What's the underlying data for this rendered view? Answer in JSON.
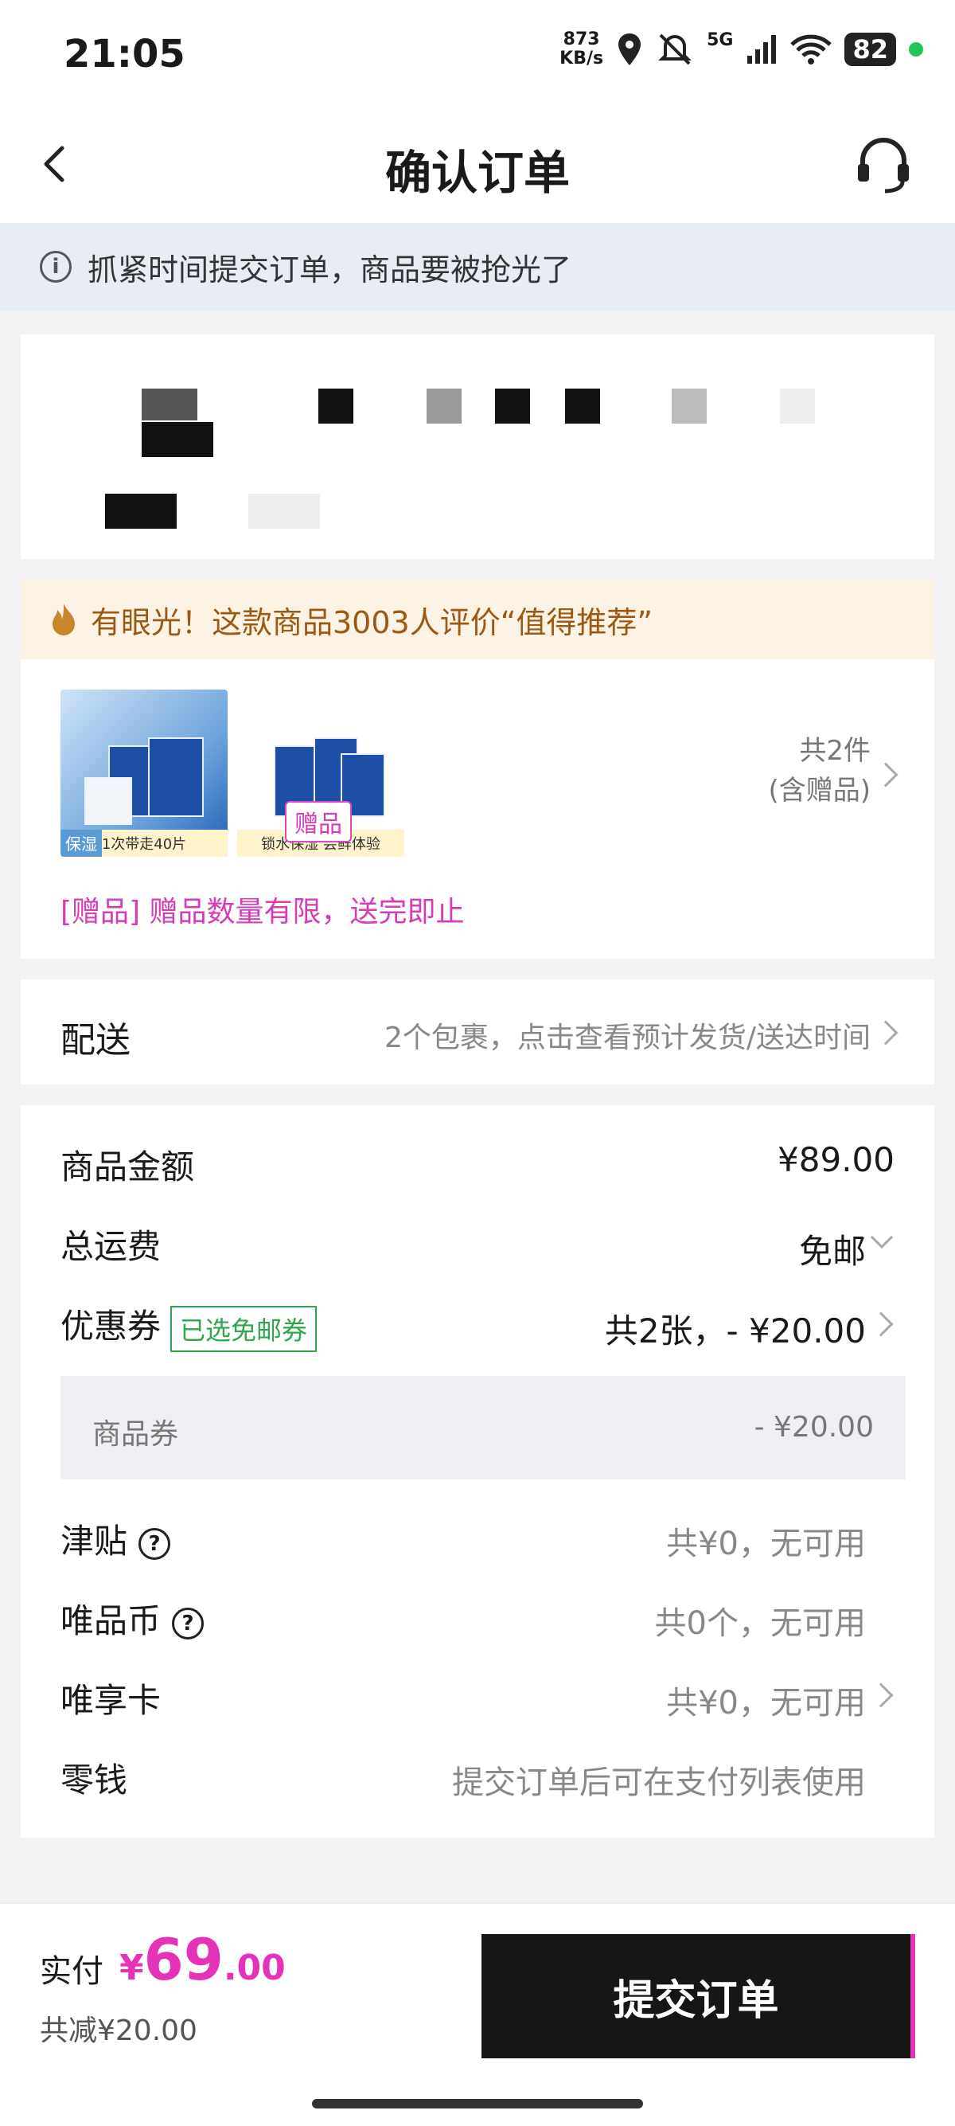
{
  "status_bar": {
    "time": "21:05",
    "net_speed_value": "873",
    "net_speed_unit": "KB/s",
    "signal": "5G",
    "battery": "82"
  },
  "nav": {
    "title": "确认订单"
  },
  "notice": {
    "text": "抓紧时间提交订单，商品要被抢光了"
  },
  "recommend": {
    "text": "有眼光！这款商品3003人评价“值得推荐”"
  },
  "goods": {
    "item1_tag": "保湿",
    "item1_caption": "1次带走40片",
    "item2_caption": "锁水保湿 尝鲜体验",
    "gift_tag": "赠品",
    "count": "共2件",
    "count_note": "(含赠品)",
    "gift_note": "[赠品] 赠品数量有限，送完即止"
  },
  "delivery": {
    "label": "配送",
    "value": "2个包裹，点击查看预计发货/送达时间"
  },
  "price": {
    "goods_amount_label": "商品金额",
    "goods_amount": "¥89.00",
    "shipping_label": "总运费",
    "shipping_value": "免邮",
    "coupon_label": "优惠券",
    "coupon_badge": "已选免邮券",
    "coupon_value": "共2张，- ¥20.00",
    "coupon_sub_label": "商品券",
    "coupon_sub_value": "- ¥20.00",
    "subsidy_label": "津贴",
    "subsidy_value": "共¥0，无可用",
    "coins_label": "唯品币",
    "coins_value": "共0个，无可用",
    "card_label": "唯享卡",
    "card_value": "共¥0，无可用",
    "change_label": "零钱",
    "change_value": "提交订单后可在支付列表使用"
  },
  "bottom": {
    "pay_label": "实付",
    "currency": "¥",
    "amount_int": "69",
    "amount_dec": ".00",
    "saved": "共减¥20.00",
    "submit": "提交订单"
  },
  "colors": {
    "accent": "#e433b7",
    "green": "#2fa64a",
    "banner_bg": "#fdf3e4",
    "notice_bg": "#e8ecf5"
  }
}
